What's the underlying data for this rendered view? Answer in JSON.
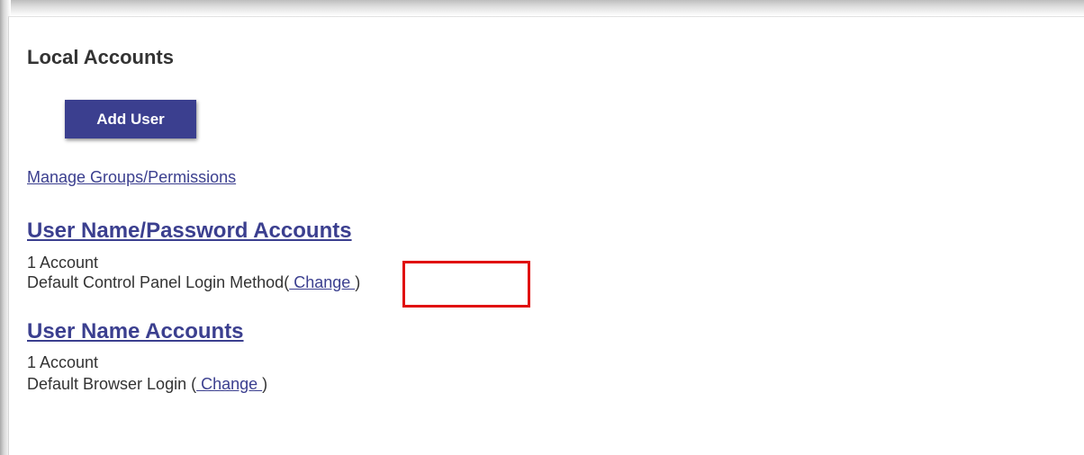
{
  "page": {
    "title": "Local Accounts"
  },
  "actions": {
    "add_user_label": "Add User",
    "manage_groups_label": "Manage Groups/Permissions"
  },
  "sections": [
    {
      "heading": "User Name/Password Accounts",
      "count": "1 Account",
      "method_label": "Default Control Panel Login Method",
      "open_paren": "(",
      "change_label": " Change ",
      "close_paren": ")"
    },
    {
      "heading": "User Name Accounts",
      "count": "1 Account",
      "method_label": "Default Browser Login ",
      "open_paren": "(",
      "change_label": " Change ",
      "close_paren": ")"
    }
  ],
  "colors": {
    "accent": "#3b3f8f",
    "highlight": "#e01010",
    "text": "#333333"
  }
}
